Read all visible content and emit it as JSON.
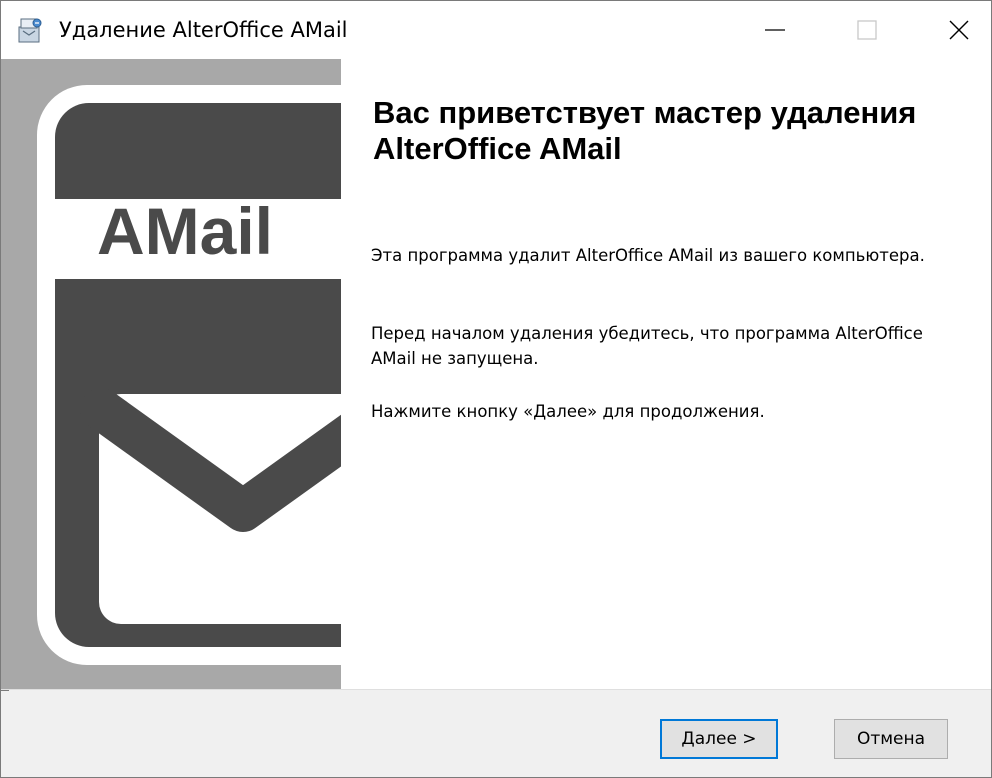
{
  "window": {
    "title": "Удаление AlterOffice AMail",
    "controls": {
      "minimize": "minimize-icon",
      "maximize": "maximize-icon",
      "close": "close-icon"
    }
  },
  "sidebar": {
    "logo_text": "AMail",
    "background_color": "#a8a8a8",
    "logo_color": "#4a4a4a"
  },
  "content": {
    "heading": "Вас приветствует мастер удаления AlterOffice AMail",
    "paragraph1": "Эта программа удалит AlterOffice AMail из вашего компьютера.",
    "paragraph2": "Перед началом удаления убедитесь, что программа AlterOffice AMail не запущена.",
    "paragraph3": "Нажмите кнопку «Далее» для продолжения."
  },
  "footer": {
    "next_label": "Далее >",
    "cancel_label": "Отмена",
    "focus_color": "#0078d7"
  }
}
